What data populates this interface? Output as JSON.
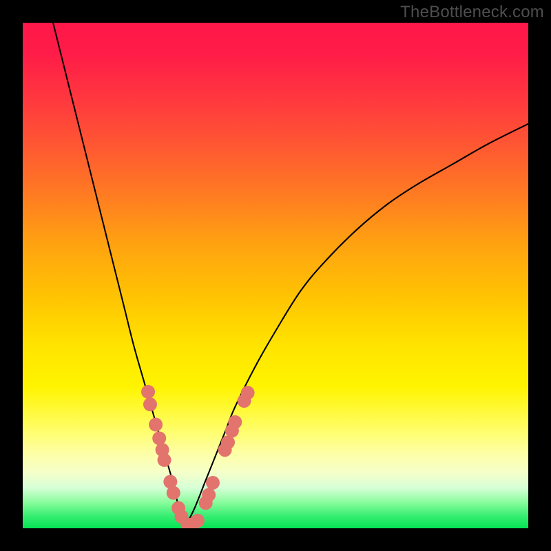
{
  "watermark": "TheBottleneck.com",
  "chart_data": {
    "type": "line",
    "title": "",
    "xlabel": "",
    "ylabel": "",
    "xlim": [
      0,
      100
    ],
    "ylim": [
      0,
      100
    ],
    "note": "Bottleneck curve: absolute relative difference between two component performance values. Minimum at x≈32 where curve touches 0 (no bottleneck). Left branch steeper than right. Y values are approximate percent mismatch read from curve height against gradient.",
    "series": [
      {
        "name": "left-branch",
        "x": [
          6,
          8,
          10,
          12,
          14,
          16,
          18,
          20,
          22,
          24,
          26,
          28,
          30,
          31,
          32
        ],
        "y": [
          100,
          92,
          84,
          76,
          68,
          60,
          52,
          44,
          36,
          29,
          22,
          15,
          8,
          3,
          0
        ]
      },
      {
        "name": "right-branch",
        "x": [
          32,
          34,
          36,
          38,
          40,
          42,
          46,
          50,
          55,
          60,
          66,
          72,
          78,
          85,
          92,
          100
        ],
        "y": [
          0,
          4,
          9,
          14,
          19,
          24,
          32,
          39,
          47,
          53,
          59,
          64,
          68,
          72,
          76,
          80
        ]
      }
    ],
    "markers": [
      {
        "x": 24.8,
        "y": 27.0
      },
      {
        "x": 25.2,
        "y": 24.5
      },
      {
        "x": 26.3,
        "y": 20.5
      },
      {
        "x": 27.0,
        "y": 17.8
      },
      {
        "x": 27.6,
        "y": 15.5
      },
      {
        "x": 28.0,
        "y": 13.5
      },
      {
        "x": 29.2,
        "y": 9.2
      },
      {
        "x": 29.8,
        "y": 7.0
      },
      {
        "x": 30.8,
        "y": 4.0
      },
      {
        "x": 31.4,
        "y": 2.3
      },
      {
        "x": 32.6,
        "y": 0.7
      },
      {
        "x": 33.6,
        "y": 0.8
      },
      {
        "x": 34.6,
        "y": 1.5
      },
      {
        "x": 36.2,
        "y": 5.0
      },
      {
        "x": 36.8,
        "y": 6.6
      },
      {
        "x": 37.6,
        "y": 9.0
      },
      {
        "x": 40.0,
        "y": 15.5
      },
      {
        "x": 40.6,
        "y": 17.0
      },
      {
        "x": 41.4,
        "y": 19.3
      },
      {
        "x": 42.0,
        "y": 21.0
      },
      {
        "x": 43.8,
        "y": 25.2
      },
      {
        "x": 44.5,
        "y": 26.8
      }
    ],
    "marker_style": {
      "color": "#e2746d",
      "radius_px": 10
    }
  }
}
